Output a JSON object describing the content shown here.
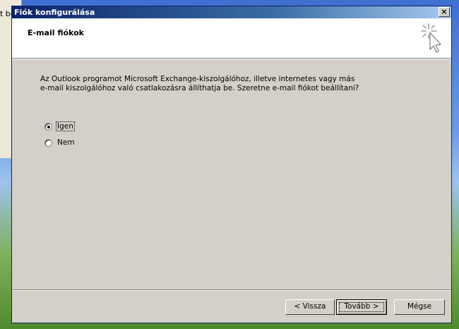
{
  "background_window": {
    "partial_text": "t be"
  },
  "dialog": {
    "title": "Fiók konfigurálása",
    "close_glyph": "×"
  },
  "header": {
    "title": "E-mail fiókok",
    "icon": "sparkle-cursor-icon"
  },
  "body": {
    "question_line1": "Az Outlook programot Microsoft Exchange-kiszolgálóhoz, illetve internetes vagy más",
    "question_line2": "e-mail kiszolgálóhoz való csatlakozásra állíthatja be. Szeretne e-mail fiókot beállítani?",
    "options": [
      {
        "label": "Igen",
        "selected": true
      },
      {
        "label": "Nem",
        "selected": false
      }
    ]
  },
  "buttons": {
    "back": "< Vissza",
    "next": "Tovább >",
    "cancel": "Mégse"
  }
}
